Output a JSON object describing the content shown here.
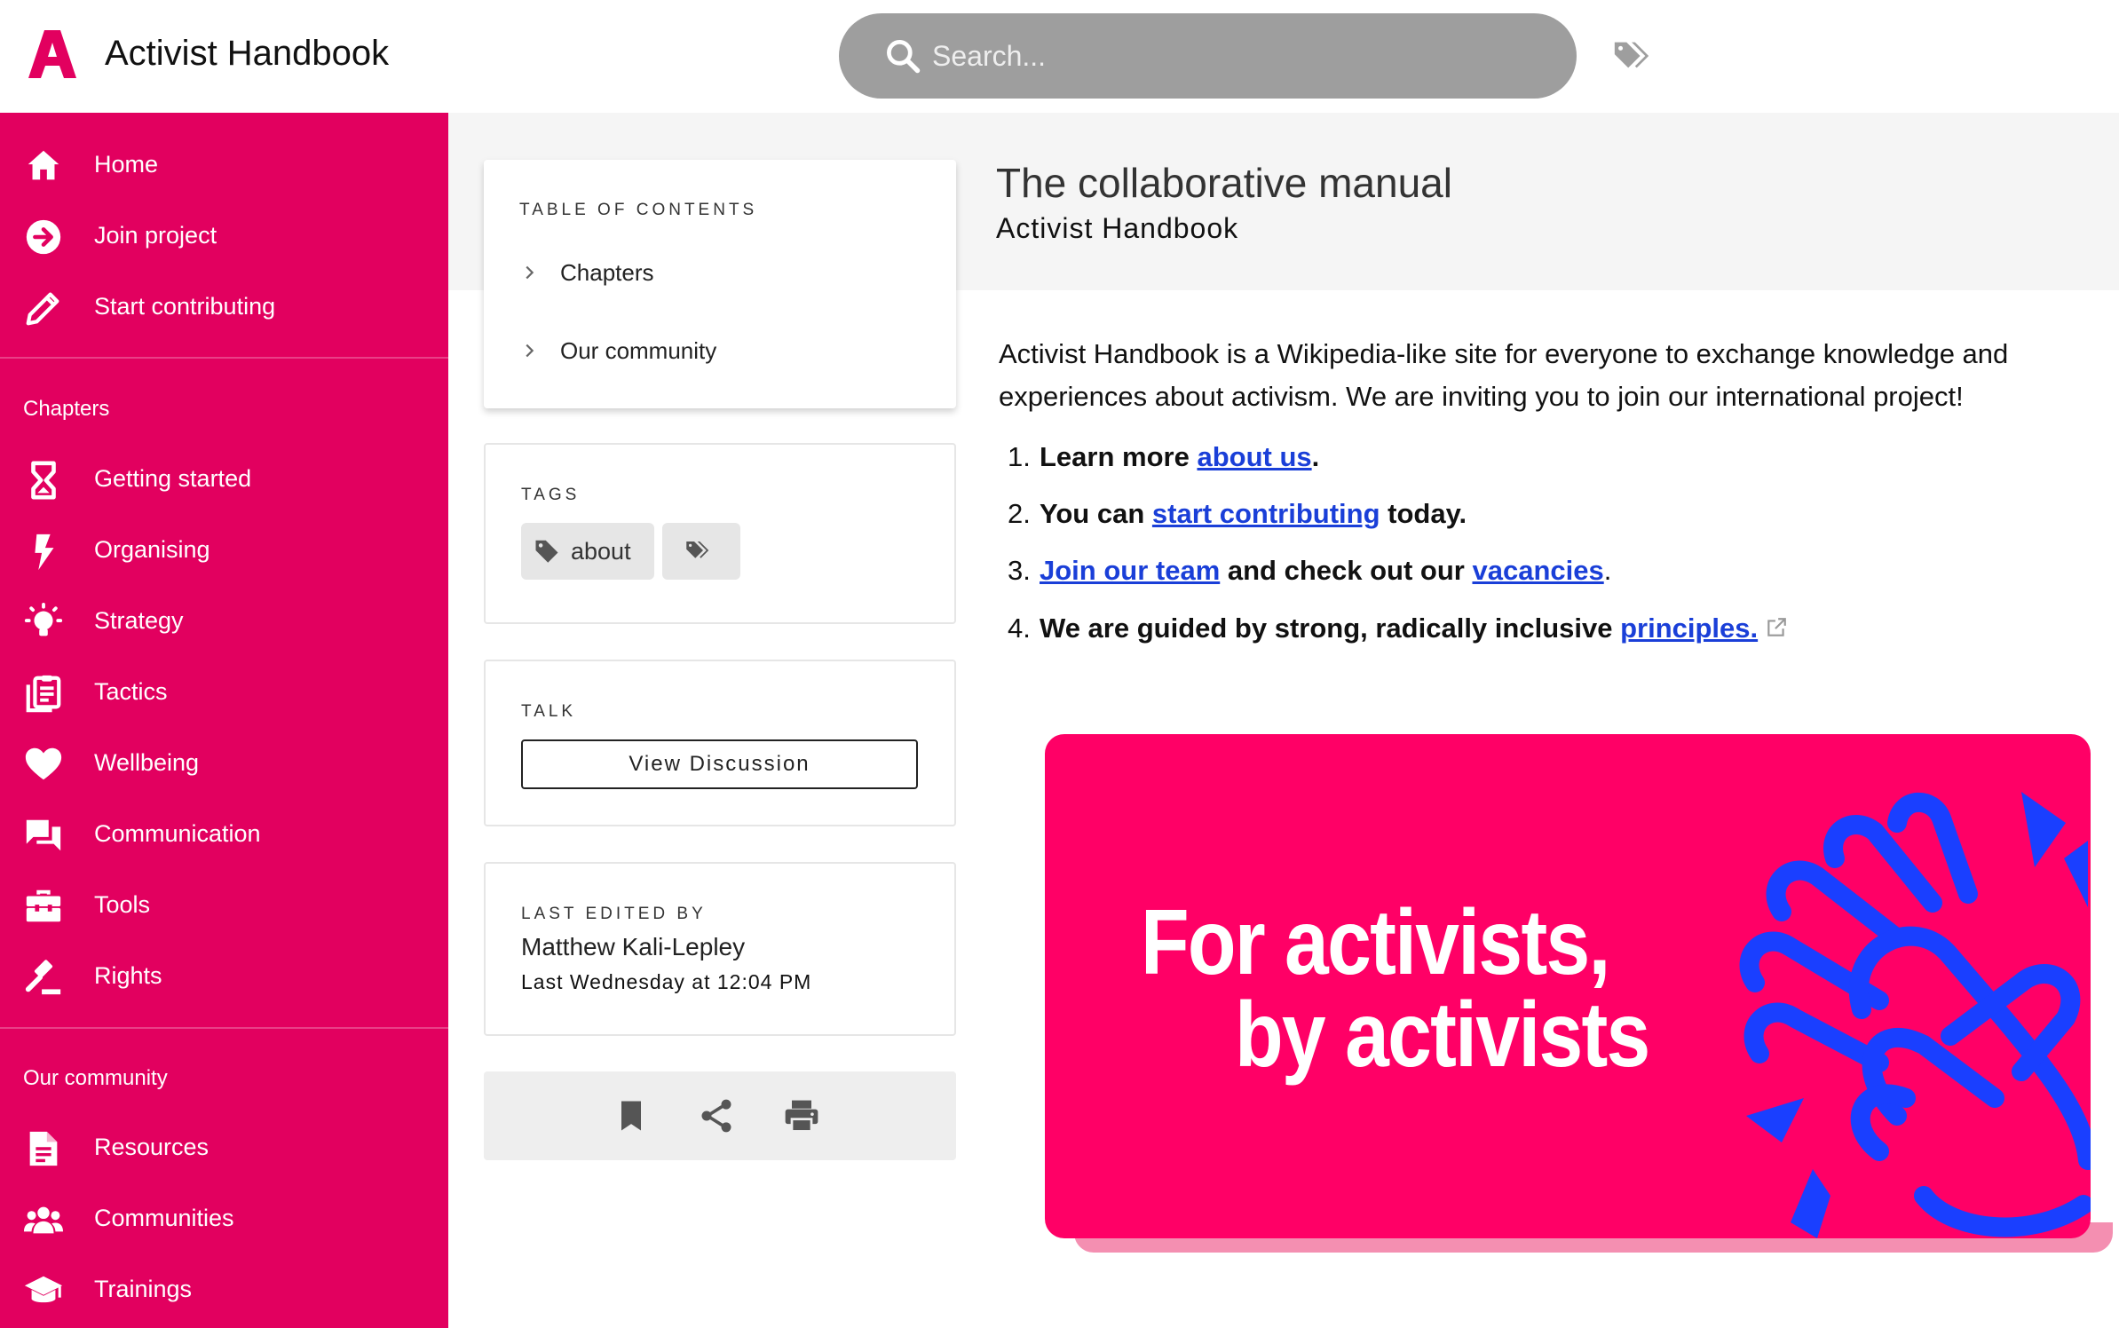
{
  "header": {
    "app_title": "Activist Handbook",
    "search_placeholder": "Search..."
  },
  "sidebar": {
    "top_items": [
      {
        "label": "Home",
        "icon": "home-icon"
      },
      {
        "label": "Join project",
        "icon": "arrow-right-circle-icon"
      },
      {
        "label": "Start contributing",
        "icon": "pencil-icon"
      }
    ],
    "chapters_title": "Chapters",
    "chapters": [
      {
        "label": "Getting started",
        "icon": "hourglass-icon"
      },
      {
        "label": "Organising",
        "icon": "lightning-icon"
      },
      {
        "label": "Strategy",
        "icon": "lightbulb-icon"
      },
      {
        "label": "Tactics",
        "icon": "clipboard-icon"
      },
      {
        "label": "Wellbeing",
        "icon": "heart-icon"
      },
      {
        "label": "Communication",
        "icon": "chat-icon"
      },
      {
        "label": "Tools",
        "icon": "toolbox-icon"
      },
      {
        "label": "Rights",
        "icon": "gavel-icon"
      }
    ],
    "community_title": "Our community",
    "community": [
      {
        "label": "Resources",
        "icon": "document-icon"
      },
      {
        "label": "Communities",
        "icon": "people-icon"
      },
      {
        "label": "Trainings",
        "icon": "graduation-cap-icon"
      }
    ]
  },
  "toc": {
    "title": "TABLE OF CONTENTS",
    "items": [
      "Chapters",
      "Our community"
    ]
  },
  "tags": {
    "title": "TAGS",
    "items": [
      "about"
    ]
  },
  "talk": {
    "title": "TALK",
    "button_label": "View Discussion"
  },
  "last_edited": {
    "title": "LAST EDITED BY",
    "editor": "Matthew Kali-Lepley",
    "time": "Last Wednesday at 12:04 PM"
  },
  "page": {
    "title": "The collaborative manual",
    "subtitle": "Activist Handbook",
    "intro": "Activist Handbook is a Wikipedia-like site for everyone to exchange knowledge and experiences about activism. We are inviting you to join our international project!",
    "list": {
      "item1": {
        "num": "1.",
        "pre": "Learn more ",
        "link": "about us",
        "post": "."
      },
      "item2": {
        "num": "2.",
        "pre": "You can ",
        "link": "start contributing",
        "post": " today."
      },
      "item3": {
        "num": "3.",
        "link1": "Join our team",
        "mid": " and check out our ",
        "link2": "vacancies",
        "post": "."
      },
      "item4": {
        "num": "4.",
        "pre": "We are guided by strong, radically inclusive ",
        "link": "principles."
      }
    }
  },
  "banner": {
    "line1": "For activists,",
    "line2": "by activists"
  },
  "colors": {
    "brand_pink": "#e2005f",
    "banner_pink": "#ff0066",
    "banner_blue": "#1a3fff",
    "link_blue": "#1a3fd8"
  }
}
